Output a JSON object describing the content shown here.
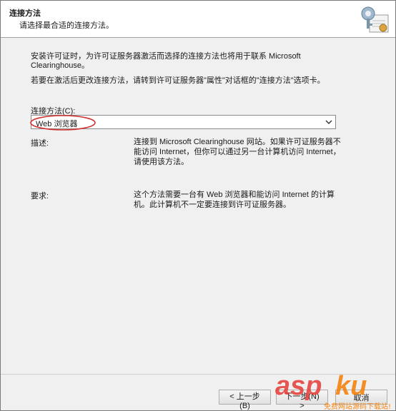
{
  "header": {
    "title": "连接方法",
    "subtitle": "请选择最合适的连接方法。",
    "icon": "certificate-key-icon"
  },
  "content": {
    "intro": "安装许可证时，为许可证服务器激活而选择的连接方法也将用于联系 Microsoft Clearinghouse。",
    "hint": "若要在激活后更改连接方法，请转到许可证服务器\"属性\"对话框的\"连接方法\"选项卡。",
    "method_label": "连接方法(C):",
    "method_value": "Web 浏览器",
    "description_label": "描述:",
    "description_text": "连接到 Microsoft Clearinghouse 网站。如果许可证服务器不能访问 Internet，但你可以通过另一台计算机访问 Internet，请使用该方法。",
    "requirements_label": "要求:",
    "requirements_text": "这个方法需要一台有 Web 浏览器和能访问 Internet 的计算机。此计算机不一定要连接到许可证服务器。"
  },
  "footer": {
    "back_label": "< 上一步(B)",
    "next_label": "下一步(N) >",
    "cancel_label": "取消"
  },
  "watermark": {
    "brand": "aspku",
    "sub": "免费网站源码下载站!",
    "colors": {
      "primary": "#e53935",
      "secondary": "#f57c00"
    }
  },
  "colors": {
    "annotation": "#d32f2f",
    "panel": "#f0f0f0"
  }
}
